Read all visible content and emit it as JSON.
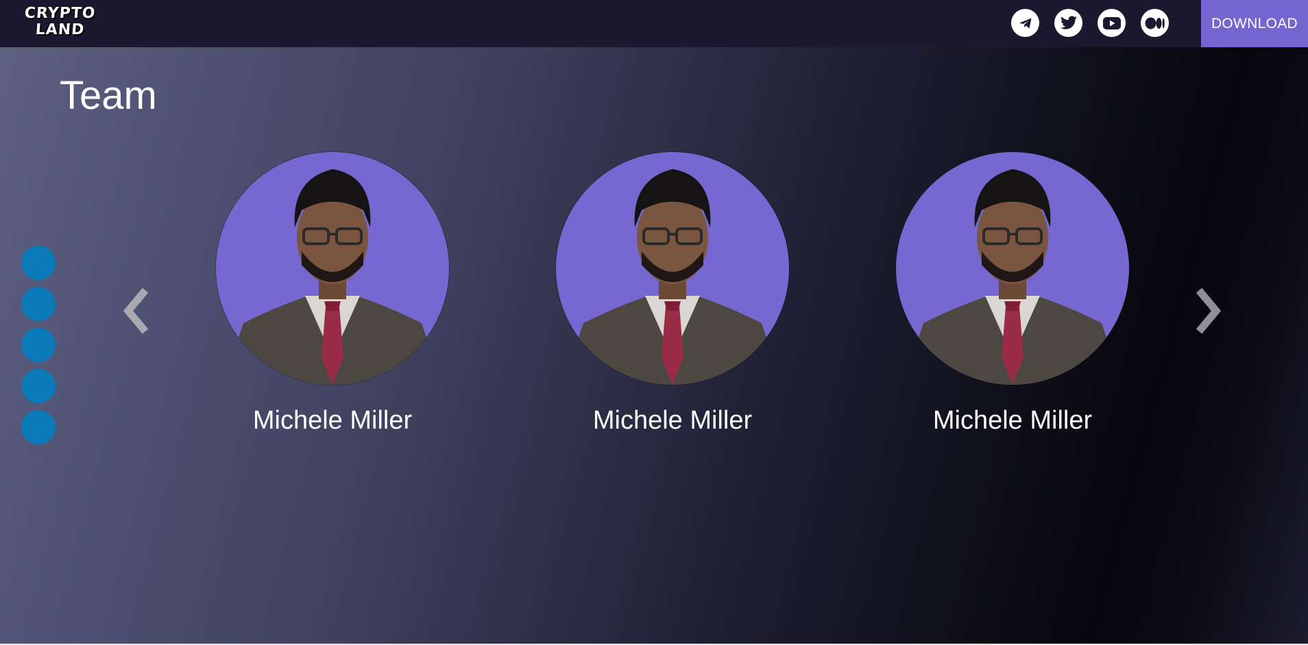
{
  "header": {
    "logo_line1": "CRYPTO",
    "logo_line2": "LAND",
    "socials": [
      {
        "icon": "telegram-icon"
      },
      {
        "icon": "twitter-icon"
      },
      {
        "icon": "youtube-icon"
      },
      {
        "icon": "medium-icon"
      }
    ],
    "download_label": "DOWNLOAD"
  },
  "team": {
    "title": "Team",
    "members": [
      {
        "name": "Michele Miller"
      },
      {
        "name": "Michele Miller"
      },
      {
        "name": "Michele Miller"
      }
    ],
    "pager_dot_count": 5
  },
  "colors": {
    "header_bg": "#1b1830",
    "download_bg": "#7465d1",
    "avatar_bg": "#7768d1",
    "dot_color": "#0a7bb8",
    "arrow_color": "#a9a9b2"
  }
}
